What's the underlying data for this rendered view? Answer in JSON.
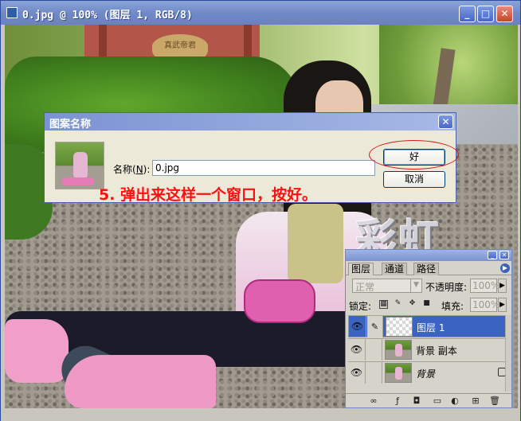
{
  "window": {
    "title": "0.jpg @ 100% (图层 1, RGB/8)",
    "controls": {
      "minimize": "_",
      "maximize": "□",
      "close": "✕"
    }
  },
  "photo": {
    "watermark": "彩虹",
    "sign_text": "真武帝君"
  },
  "dialog": {
    "title": "图案名称",
    "close": "✕",
    "name_label_prefix": "名称(",
    "name_label_key": "N",
    "name_label_suffix": "):",
    "name_value": "0.jpg",
    "ok_label": "好",
    "cancel_label": "取消",
    "annotation": "5. 弹出来这样一个窗口，按好。",
    "annotation_color": "#ff1010"
  },
  "layers_panel": {
    "title_buttons": {
      "minimize": "_",
      "close": "✕"
    },
    "tabs": [
      {
        "label": "图层",
        "active": true
      },
      {
        "label": "通道",
        "active": false
      },
      {
        "label": "路径",
        "active": false
      }
    ],
    "menu_icon": "▶",
    "blend_mode": "正常",
    "opacity_label": "不透明度:",
    "opacity_value": "100%",
    "lock_label": "锁定:",
    "lock_icons": [
      "lock-transparent-icon",
      "lock-paint-icon",
      "lock-move-icon",
      "lock-all-icon"
    ],
    "fill_label": "填充:",
    "fill_value": "100%",
    "layers": [
      {
        "name": "图层 1",
        "selected": true,
        "thumbnail": "transparent",
        "locked": false
      },
      {
        "name": "背景 副本",
        "selected": false,
        "thumbnail": "photo",
        "locked": false
      },
      {
        "name": "背景",
        "selected": false,
        "thumbnail": "photo",
        "locked": true
      }
    ],
    "bottom_icons": [
      "link-icon",
      "layer-style-icon",
      "mask-icon",
      "group-icon",
      "adjustment-icon",
      "new-layer-icon",
      "trash-icon"
    ],
    "selection_color": "#3a63c2"
  }
}
